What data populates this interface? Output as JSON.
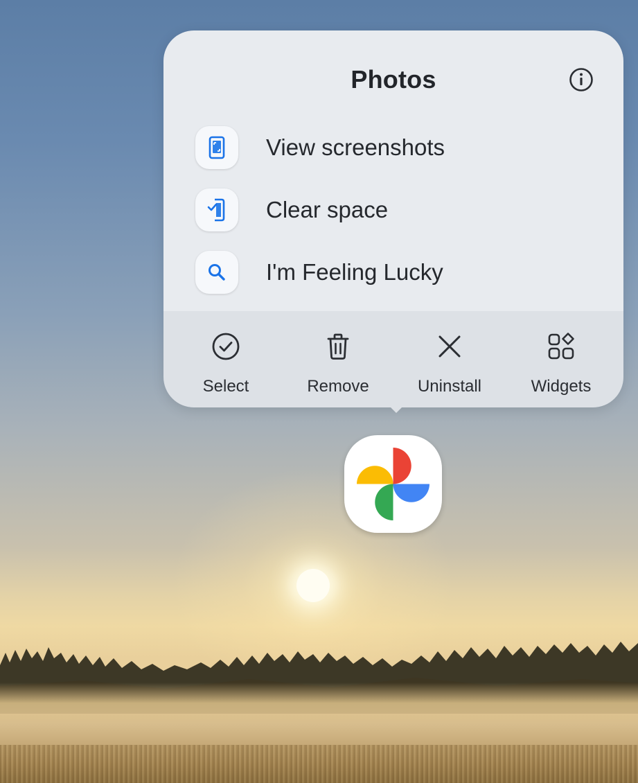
{
  "popup": {
    "title": "Photos",
    "info_icon": "info-circle-icon",
    "shortcuts": [
      {
        "label": "View screenshots",
        "icon": "screenshot-phone-icon"
      },
      {
        "label": "Clear space",
        "icon": "phone-check-icon"
      },
      {
        "label": "I'm Feeling Lucky",
        "icon": "search-icon"
      }
    ],
    "actions": [
      {
        "label": "Select",
        "icon": "check-circle-icon"
      },
      {
        "label": "Remove",
        "icon": "trash-icon"
      },
      {
        "label": "Uninstall",
        "icon": "close-icon"
      },
      {
        "label": "Widgets",
        "icon": "widgets-icon"
      }
    ]
  },
  "app_icon": {
    "name": "google-photos-icon"
  },
  "colors": {
    "accent_blue": "#1a73e8",
    "google_red": "#ea4335",
    "google_yellow": "#fbbc04",
    "google_green": "#34a853",
    "google_blue": "#4285f4"
  }
}
